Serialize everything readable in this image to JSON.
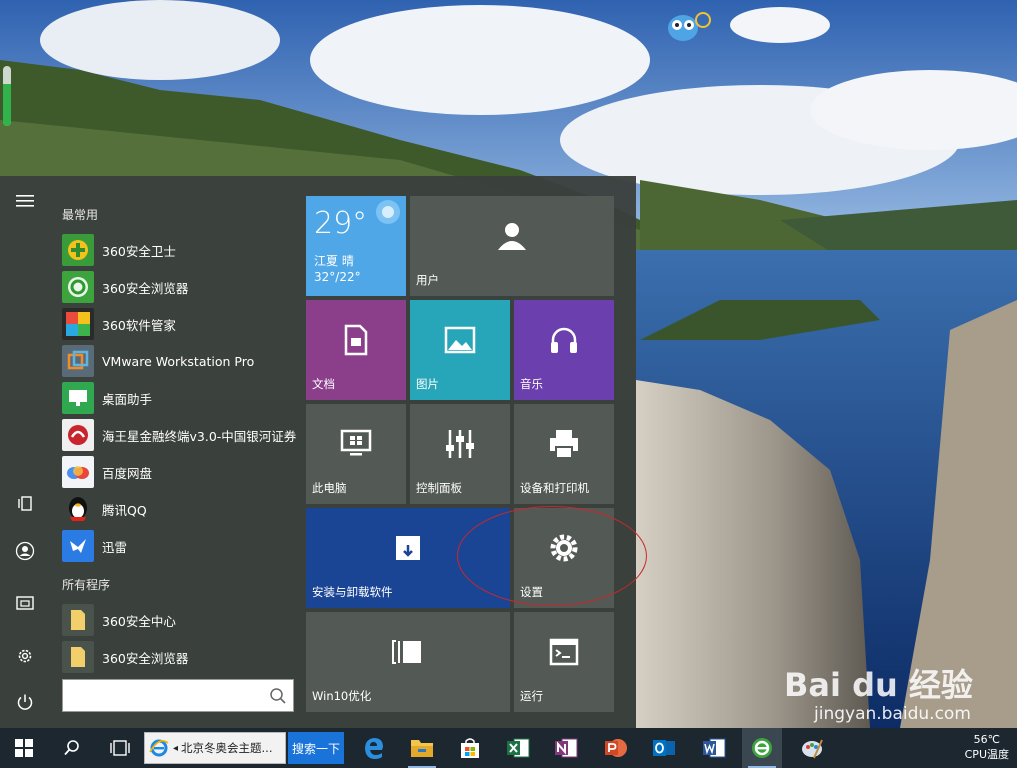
{
  "start_menu": {
    "frequent_header": "最常用",
    "frequent_apps": [
      {
        "label": "360安全卫士",
        "icon": "360-safeguard-icon"
      },
      {
        "label": "360安全浏览器",
        "icon": "360-browser-icon"
      },
      {
        "label": "360软件管家",
        "icon": "360-software-manager-icon"
      },
      {
        "label": "VMware Workstation Pro",
        "icon": "vmware-icon"
      },
      {
        "label": "桌面助手",
        "icon": "desktop-assistant-icon"
      },
      {
        "label": "海王星金融终端v3.0-中国银河证券",
        "icon": "neptune-finance-icon"
      },
      {
        "label": "百度网盘",
        "icon": "baidu-netdisk-icon"
      },
      {
        "label": "腾讯QQ",
        "icon": "qq-penguin-icon"
      },
      {
        "label": "迅雷",
        "icon": "xunlei-bird-icon"
      }
    ],
    "all_programs_header": "所有程序",
    "all_programs": [
      {
        "label": "360安全中心",
        "icon": "folder-icon"
      },
      {
        "label": "360安全浏览器",
        "icon": "folder-icon"
      }
    ],
    "search_placeholder": ""
  },
  "tiles": {
    "weather": {
      "temp": "29°",
      "location": "江夏 晴",
      "range": "32°/22°",
      "color": "#4fa7e8"
    },
    "user": {
      "label": "用户",
      "color": "#535a55"
    },
    "documents": {
      "label": "文档",
      "color": "#8b3f8a"
    },
    "pictures": {
      "label": "图片",
      "color": "#26a6b8"
    },
    "music": {
      "label": "音乐",
      "color": "#6b3fad"
    },
    "this_pc": {
      "label": "此电脑",
      "color": "#535a55"
    },
    "control_panel": {
      "label": "控制面板",
      "color": "#535a55"
    },
    "devices_printers": {
      "label": "设备和打印机",
      "color": "#535a55"
    },
    "install_uninstall": {
      "label": "安装与卸载软件",
      "color": "#1a4594"
    },
    "settings": {
      "label": "设置",
      "color": "#535a55"
    },
    "win10_optimize": {
      "label": "Win10优化",
      "color": "#535a55"
    },
    "run": {
      "label": "运行",
      "color": "#535a55"
    }
  },
  "taskbar": {
    "ie_tab_title": "北京冬奥会主题...",
    "ie_search_label": "搜索一下",
    "pinned": [
      "edge-icon",
      "file-explorer-icon",
      "store-icon",
      "excel-icon",
      "onenote-icon",
      "powerpoint-icon",
      "outlook-icon",
      "word-icon",
      "360-browser-icon",
      "paint-icon"
    ],
    "temperature": "56℃",
    "temperature_label": "CPU温度"
  },
  "watermark": {
    "brand": "Bai du 经验",
    "url": "jingyan.baidu.com"
  }
}
